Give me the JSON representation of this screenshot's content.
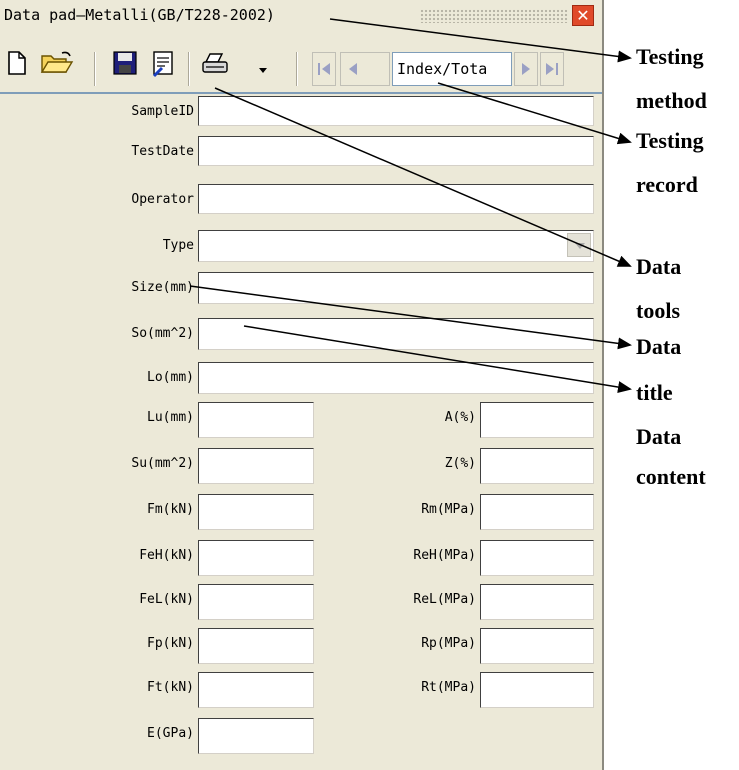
{
  "window": {
    "title": "Data pad—Metalli(GB/T228-2002)",
    "close_icon": "close-icon"
  },
  "toolbar": {
    "icons": [
      "new-document-icon",
      "open-folder-icon",
      "save-icon",
      "data-tools-icon",
      "print-icon",
      "dropdown-arrow-icon",
      "first-record-icon",
      "previous-record-icon",
      "next-record-icon",
      "last-record-icon"
    ],
    "record_indicator": "Index/Tota"
  },
  "form": {
    "wide_fields": [
      {
        "label": "SampleID",
        "value": ""
      },
      {
        "label": "TestDate",
        "value": ""
      },
      {
        "label": "Operator",
        "value": ""
      },
      {
        "label": "Type",
        "value": ""
      },
      {
        "label": "Size(mm)",
        "value": ""
      },
      {
        "label": "So(mm^2)",
        "value": ""
      },
      {
        "label": "Lo(mm)",
        "value": ""
      }
    ],
    "left_fields": [
      {
        "label": "Lu(mm)",
        "value": ""
      },
      {
        "label": "Su(mm^2)",
        "value": ""
      },
      {
        "label": "Fm(kN)",
        "value": ""
      },
      {
        "label": "FeH(kN)",
        "value": ""
      },
      {
        "label": "FeL(kN)",
        "value": ""
      },
      {
        "label": "Fp(kN)",
        "value": ""
      },
      {
        "label": "Ft(kN)",
        "value": ""
      },
      {
        "label": "E(GPa)",
        "value": ""
      }
    ],
    "right_fields": [
      {
        "label": "A(%)",
        "value": ""
      },
      {
        "label": "Z(%)",
        "value": ""
      },
      {
        "label": "Rm(MPa)",
        "value": ""
      },
      {
        "label": "ReH(MPa)",
        "value": ""
      },
      {
        "label": "ReL(MPa)",
        "value": ""
      },
      {
        "label": "Rp(MPa)",
        "value": ""
      },
      {
        "label": "Rt(MPa)",
        "value": ""
      }
    ]
  },
  "annotations": [
    "Testing",
    "method",
    "Testing",
    "record",
    "Data",
    "tools",
    "Data",
    "title",
    "Data",
    "content"
  ]
}
